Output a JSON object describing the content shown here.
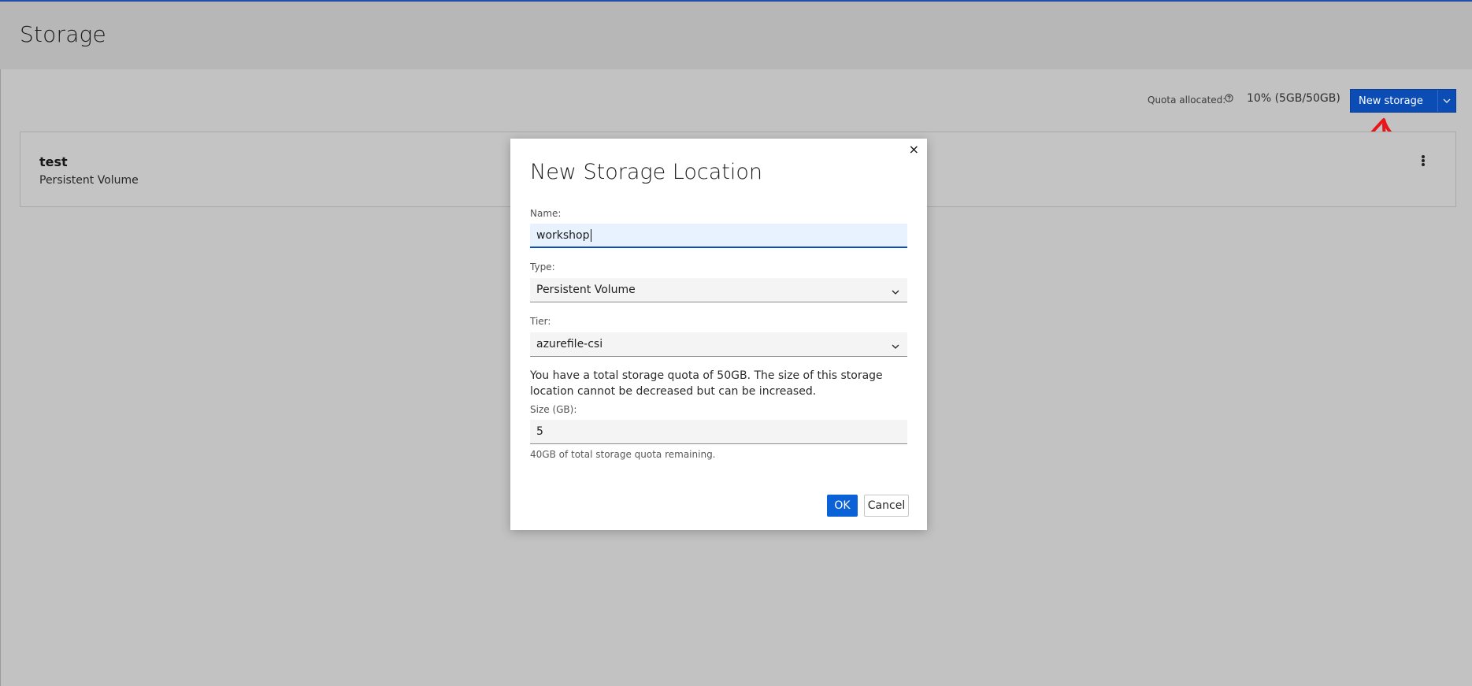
{
  "header": {
    "title": "Storage"
  },
  "toolbar": {
    "quota_label": "Quota allocated:",
    "quota_value": "10% (5GB/50GB)",
    "new_storage_label": "New storage"
  },
  "storage_list": [
    {
      "name": "test",
      "type": "Persistent Volume"
    }
  ],
  "modal": {
    "title": "New Storage Location",
    "close_symbol": "×",
    "name_label": "Name:",
    "name_value": "workshop",
    "type_label": "Type:",
    "type_value": "Persistent Volume",
    "tier_label": "Tier:",
    "tier_value": "azurefile-csi",
    "info_text": "You have a total storage quota of 50GB. The size of this storage location cannot be decreased but can be increased.",
    "size_label": "Size (GB):",
    "size_value": "5",
    "helper_text": "40GB of total storage quota remaining.",
    "ok_label": "OK",
    "cancel_label": "Cancel"
  },
  "colors": {
    "primary": "#0b4db4",
    "annotation_arrow": "#e8161b"
  },
  "icons": [
    "help-icon",
    "chevron-down-icon",
    "kebab-menu-icon",
    "close-icon",
    "annotation-arrow-icon"
  ]
}
